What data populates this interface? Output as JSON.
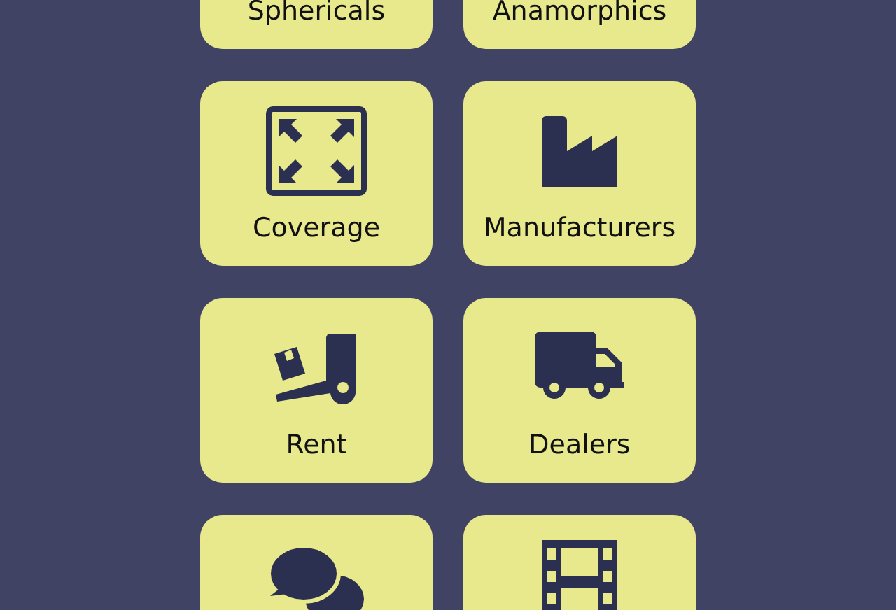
{
  "tiles": [
    {
      "label": "Sphericals"
    },
    {
      "label": "Anamorphics"
    },
    {
      "label": "Coverage",
      "kind": "coverage"
    },
    {
      "label": "Manufacturers",
      "kind": "factory"
    },
    {
      "label": "Rent",
      "kind": "dolly"
    },
    {
      "label": "Dealers",
      "kind": "truck"
    },
    {
      "kind": "chat"
    },
    {
      "kind": "film"
    }
  ]
}
